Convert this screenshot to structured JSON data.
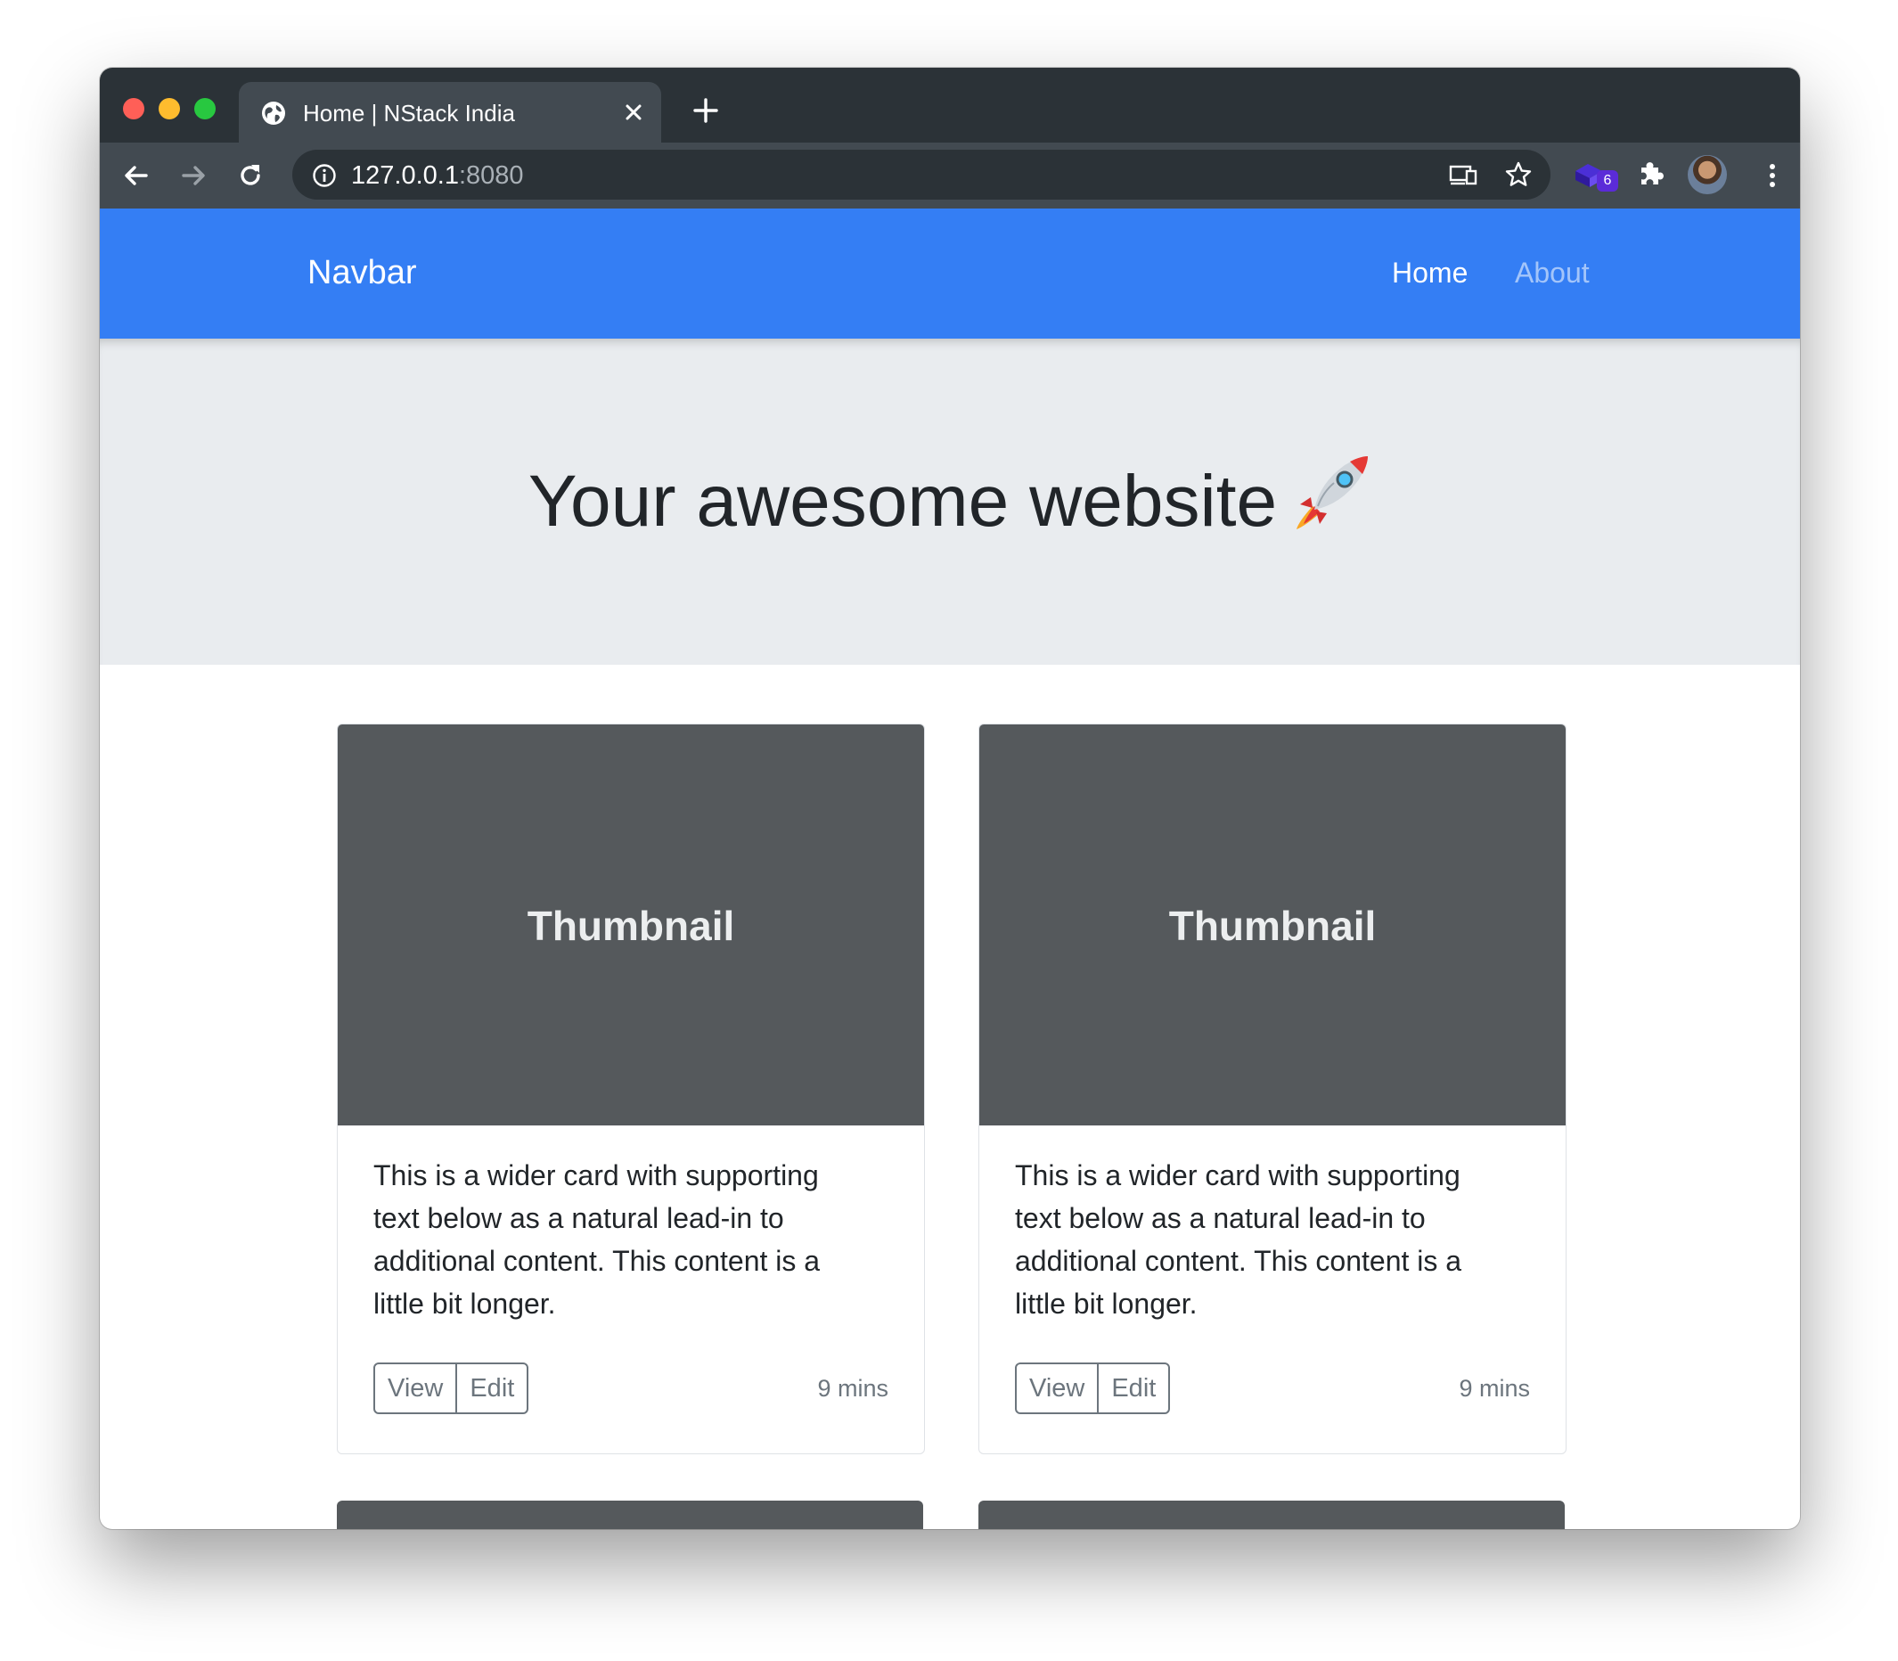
{
  "browser": {
    "tab": {
      "title": "Home | NStack India"
    },
    "address_bar": {
      "host": "127.0.0.1",
      "port": ":8080"
    },
    "extension_badge": "6"
  },
  "navbar": {
    "brand": "Navbar",
    "links": [
      {
        "label": "Home",
        "active": true
      },
      {
        "label": "About",
        "active": false
      }
    ]
  },
  "hero": {
    "title": "Your awesome website"
  },
  "cards": [
    {
      "thumbnail_label": "Thumbnail",
      "text": "This is a wider card with supporting text below as a natural lead-in to additional content. This content is a little bit longer.",
      "view_label": "View",
      "edit_label": "Edit",
      "meta": "9 mins"
    },
    {
      "thumbnail_label": "Thumbnail",
      "text": "This is a wider card with supporting text below as a natural lead-in to additional content. This content is a little bit longer.",
      "view_label": "View",
      "edit_label": "Edit",
      "meta": "9 mins"
    }
  ],
  "colors": {
    "navbar": "#347ef4",
    "hero_bg": "#e9ecef",
    "thumbnail_bg": "#55595c",
    "browser_chrome": "#2b3237"
  },
  "icons": [
    "globe-icon",
    "close-icon",
    "plus-icon",
    "back-arrow-icon",
    "forward-arrow-icon",
    "reload-icon",
    "info-icon",
    "cast-icon",
    "star-icon",
    "extension-icon",
    "puzzle-icon",
    "avatar",
    "more-vert-icon",
    "rocket-icon"
  ]
}
